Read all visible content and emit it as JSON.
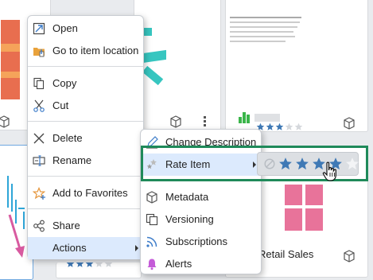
{
  "context_menu": {
    "items": [
      {
        "label": "Open",
        "icon": "open-icon"
      },
      {
        "label": "Go to item location",
        "icon": "folder-location-icon"
      },
      {
        "label": "Copy",
        "icon": "copy-icon"
      },
      {
        "label": "Cut",
        "icon": "cut-icon"
      },
      {
        "label": "Delete",
        "icon": "delete-icon"
      },
      {
        "label": "Rename",
        "icon": "rename-icon"
      },
      {
        "label": "Add to Favorites",
        "icon": "favorites-star-icon"
      },
      {
        "label": "Share",
        "icon": "share-icon"
      },
      {
        "label": "Actions",
        "icon": "actions-icon"
      }
    ]
  },
  "actions_submenu": {
    "items": [
      {
        "label": "Change Description",
        "icon": "pencil-icon"
      },
      {
        "label": "Rate Item",
        "icon": "rate-stars-icon"
      },
      {
        "label": "Metadata",
        "icon": "metadata-cube-icon"
      },
      {
        "label": "Versioning",
        "icon": "versioning-icon"
      },
      {
        "label": "Subscriptions",
        "icon": "subscriptions-icon"
      },
      {
        "label": "Alerts",
        "icon": "bell-icon"
      }
    ]
  },
  "rating_picker": {
    "current_hover_rating": 4,
    "max_rating": 5,
    "highlight_color": "#1f8a5a"
  },
  "cards": {
    "bottom_right_title": "Retail Sales"
  },
  "colors": {
    "star_filled": "#3f79b5",
    "star_empty": "#d5d8dc",
    "pink": "#e8739a",
    "teal": "#37c6c0",
    "green": "#3ab54a",
    "alert_bell": "#c45bd8"
  }
}
